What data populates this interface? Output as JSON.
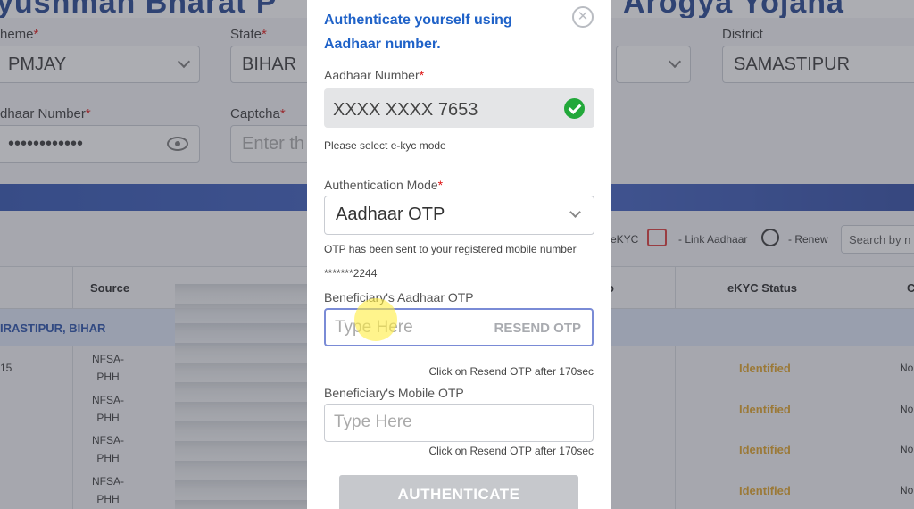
{
  "background": {
    "title_left": "yushman Bharat P",
    "title_right": "Arogya Yojana",
    "filters": {
      "scheme_label": "heme",
      "scheme_value": "PMJAY",
      "state_label": "State",
      "state_value": "BIHAR",
      "district_label": "District",
      "district_value": "SAMASTIPUR",
      "aadhaar_label": "dhaar Number",
      "aadhaar_value": "••••••••••••",
      "captcha_label": "Captcha",
      "captcha_placeholder": "Enter th"
    },
    "toolbar": {
      "ekyc_label": "eKYC",
      "link_aadhaar_label": "- Link Aadhaar",
      "renew_label": "- Renew",
      "search_placeholder": "Search by n"
    },
    "table": {
      "columns": [
        "Source",
        "o",
        "eKYC Status",
        "C"
      ],
      "group_label": "IRASTIPUR, BIHAR",
      "rows": [
        {
          "id": "15",
          "source": "NFSA-PHH",
          "ekyc_status": "Identified",
          "last": "No"
        },
        {
          "id": "",
          "source": "NFSA-PHH",
          "ekyc_status": "Identified",
          "last": "No"
        },
        {
          "id": "",
          "source": "NFSA-PHH",
          "ekyc_status": "Identified",
          "last": "No"
        },
        {
          "id": "",
          "source": "NFSA-PHH",
          "ekyc_status": "Identified",
          "last": "No"
        }
      ]
    }
  },
  "modal": {
    "title": "Authenticate yourself using Aadhaar number.",
    "close_symbol": "✕",
    "aadhaar_label": "Aadhaar Number",
    "aadhaar_value": "XXXX XXXX 7653",
    "select_mode_note": "Please select e-kyc mode",
    "auth_mode_label": "Authentication Mode",
    "auth_mode_value": "Aadhaar OTP",
    "otp_sent_note": "OTP has been sent to your registered mobile number",
    "masked_mobile": "*******2244",
    "aadhaar_otp_label": "Beneficiary's Aadhaar OTP",
    "aadhaar_otp_placeholder": "Type Here",
    "resend_label": "RESEND OTP",
    "resend_hint_1": "Click on Resend OTP after 170sec",
    "mobile_otp_label": "Beneficiary's Mobile OTP",
    "mobile_otp_placeholder": "Type Here",
    "resend_hint_2": "Click on Resend OTP after 170sec",
    "authenticate_label": "AUTHENTICATE",
    "colors": {
      "accent": "#1f62c8",
      "verified": "#22a83a",
      "disabled_button": "#c6c8cc"
    }
  }
}
